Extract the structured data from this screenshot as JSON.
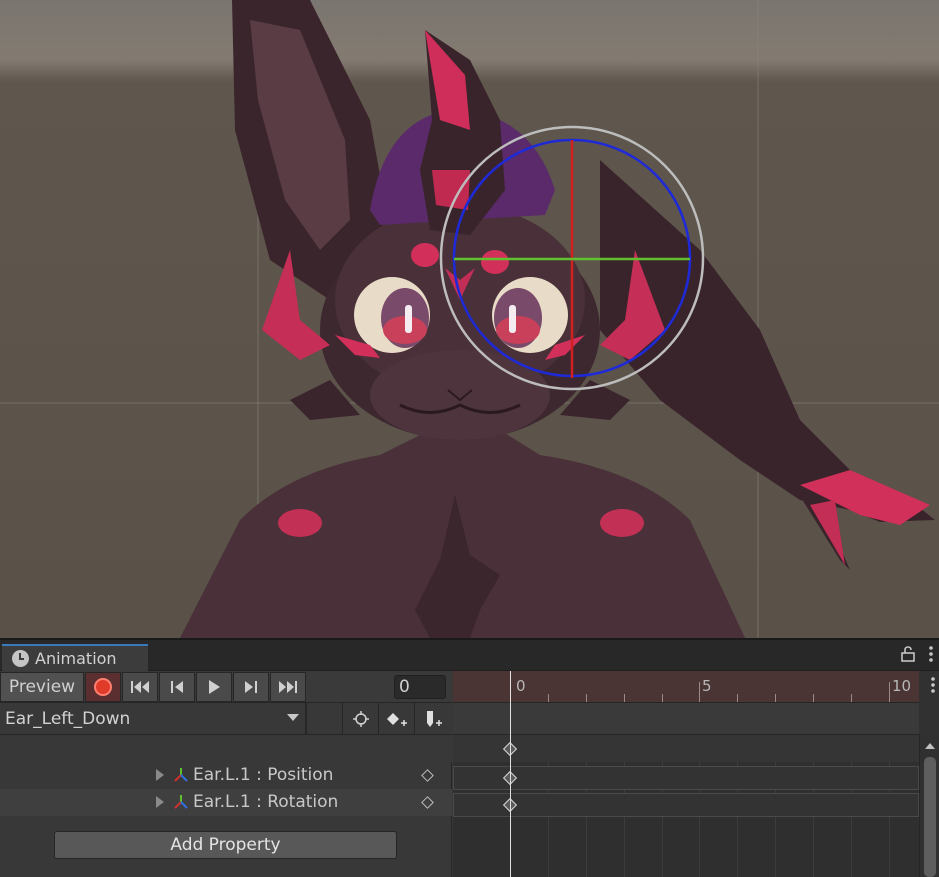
{
  "window": {
    "tab_title": "Animation",
    "lock_icon": "lock-icon",
    "menu_icon": "kebab-menu-icon"
  },
  "toolbar": {
    "preview_label": "Preview",
    "record_icon": "record-icon",
    "first_key_icon": "skip-to-start-icon",
    "prev_key_icon": "previous-key-icon",
    "play_icon": "play-icon",
    "next_key_icon": "next-key-icon",
    "last_key_icon": "skip-to-end-icon",
    "frame_value": "0"
  },
  "clip": {
    "selected_clip": "Ear_Left_Down",
    "tools": [
      "filter-by-selection-icon",
      "add-keyframe-icon",
      "add-event-icon"
    ]
  },
  "properties": [
    {
      "label": "Ear.L.1 : Position"
    },
    {
      "label": "Ear.L.1 : Rotation"
    }
  ],
  "add_property_label": "Add Property",
  "timeline": {
    "ruler_labels": [
      "0",
      "5",
      "10"
    ],
    "current_frame": 0
  },
  "colors": {
    "accent": "#3a79bb",
    "record": "#e03a2a",
    "gizmo_x": "#d02020",
    "gizmo_y": "#60c030",
    "gizmo_z": "#2030d0"
  }
}
